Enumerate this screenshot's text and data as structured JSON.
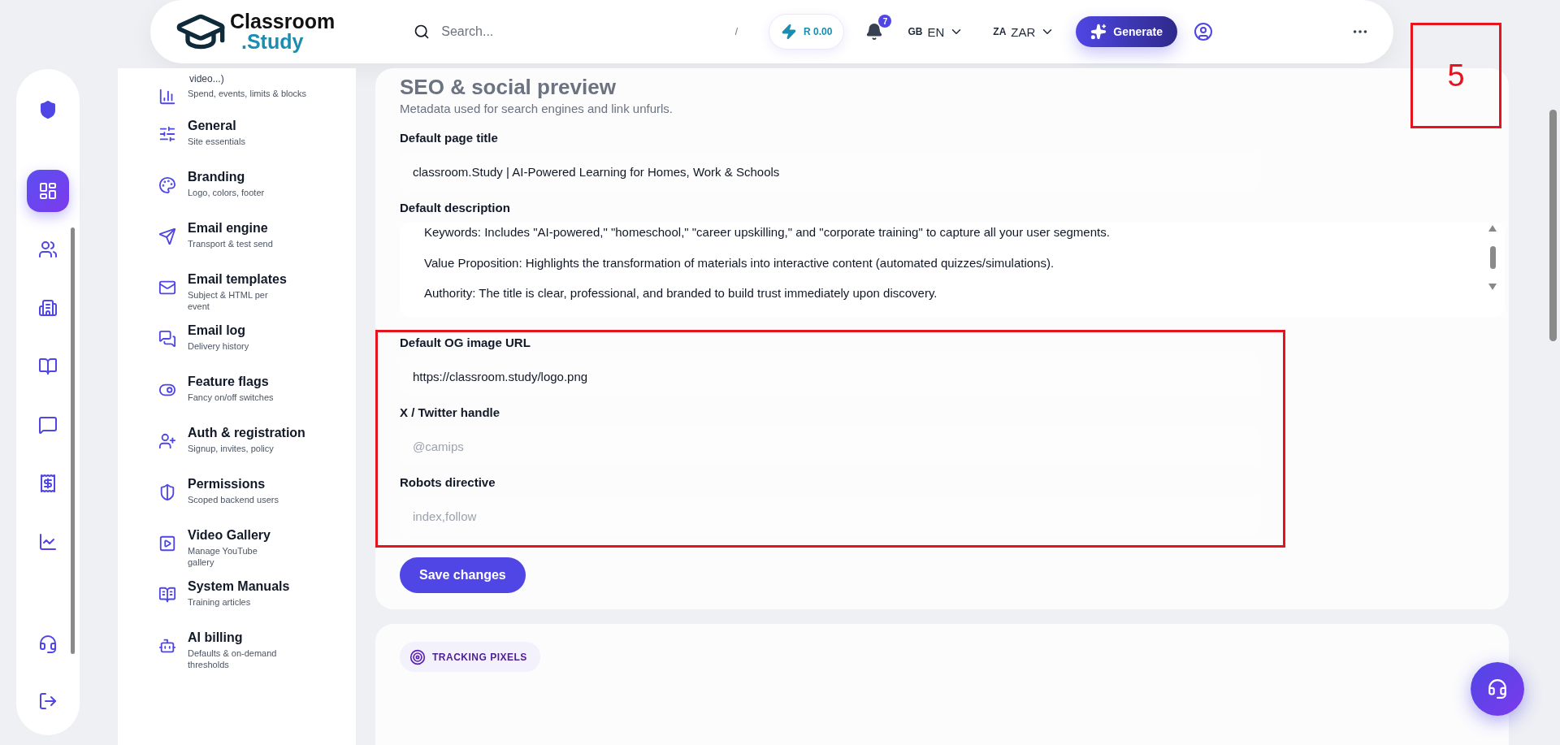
{
  "header": {
    "logo_top": "Classroom",
    "logo_bottom": ".Study",
    "search": {
      "placeholder": "Search...",
      "shortcut": "/"
    },
    "credits": "R 0.00",
    "notifications": "7",
    "language": {
      "code": "GB",
      "label": "EN"
    },
    "currency": {
      "code": "ZA",
      "label": "ZAR"
    },
    "generate": "Generate"
  },
  "rail": [
    {
      "selected": true
    },
    {
      "selected": false
    },
    {
      "selected": false
    },
    {
      "selected": false
    },
    {
      "selected": false
    },
    {
      "selected": false
    },
    {
      "selected": false
    }
  ],
  "menu": {
    "overflow_text": "video...)",
    "items": [
      {
        "subtitle": "Spend, events, limits & blocks"
      },
      {
        "title": "General",
        "subtitle": "Site essentials"
      },
      {
        "title": "Branding",
        "subtitle": "Logo, colors, footer"
      },
      {
        "title": "Email engine",
        "subtitle": "Transport & test send"
      },
      {
        "title": "Email templates",
        "subtitle": "Subject & HTML per event"
      },
      {
        "title": "Email log",
        "subtitle": "Delivery history"
      },
      {
        "title": "Feature flags",
        "subtitle": "Fancy on/off switches"
      },
      {
        "title": "Auth & registration",
        "subtitle": "Signup, invites, policy"
      },
      {
        "title": "Permissions",
        "subtitle": "Scoped backend users"
      },
      {
        "title": "Video Gallery",
        "subtitle": "Manage YouTube gallery"
      },
      {
        "title": "System Manuals",
        "subtitle": "Training articles"
      },
      {
        "title": "AI billing",
        "subtitle": "Defaults & on-demand thresholds"
      }
    ]
  },
  "card": {
    "title": "SEO & social preview",
    "subtitle": "Metadata used for search engines and link unfurls.",
    "fields": [
      {
        "kind": "text",
        "label": "Default page title",
        "value": "classroom.Study | AI-Powered Learning for Homes, Work & Schools",
        "highlighted": false
      },
      {
        "kind": "textarea",
        "label": "Default description",
        "value": "Keywords: Includes \"AI-powered,\" \"homeschool,\" \"career upskilling,\" and \"corporate training\" to capture all your user segments.\n\nValue Proposition: Highlights the transformation of materials into interactive content (automated quizzes/simulations).\n\nAuthority: The title is clear, professional, and branded to build trust immediately upon discovery.",
        "highlighted": false
      },
      {
        "kind": "text",
        "label": "Default OG image URL",
        "value": "https://classroom.study/logo.png",
        "highlighted": true
      },
      {
        "kind": "text",
        "label": "X / Twitter handle",
        "placeholder": "@camips",
        "highlighted": true
      },
      {
        "kind": "text",
        "label": "Robots directive",
        "placeholder": "index,follow",
        "highlighted": true
      }
    ],
    "save": "Save changes"
  },
  "next_section": {
    "badge": "TRACKING PIXELS"
  },
  "annotation": {
    "label": "5"
  }
}
